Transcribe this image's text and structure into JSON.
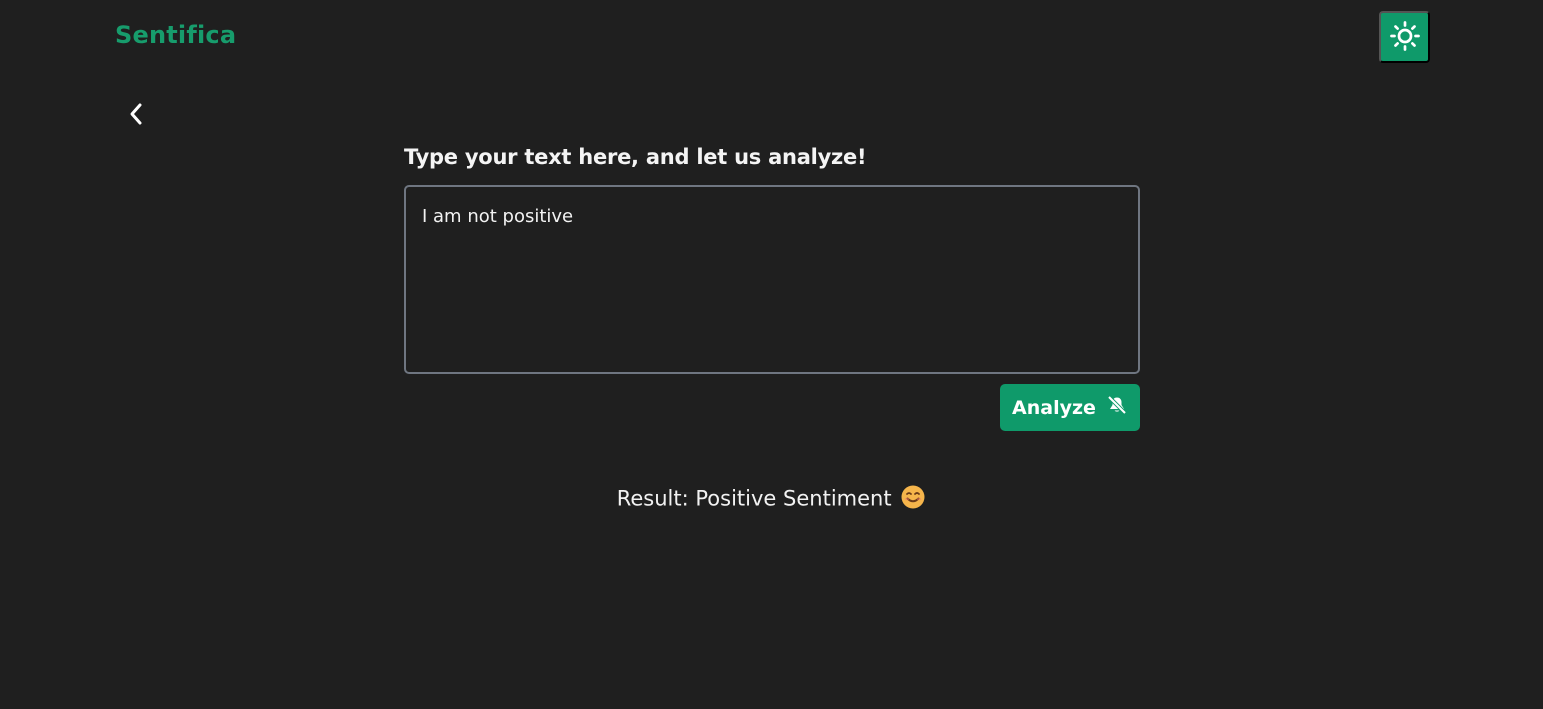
{
  "header": {
    "brand": "Sentifica",
    "theme_toggle_icon": "sun-icon"
  },
  "navigation": {
    "back_icon": "chevron-left-icon"
  },
  "analyzer": {
    "prompt_label": "Type your text here, and let us analyze!",
    "input_value": "I am not positive",
    "analyze_label": "Analyze",
    "analyze_icon": "bell-off-icon"
  },
  "result": {
    "prefix": "Result:",
    "sentiment": "Positive Sentiment",
    "emoji_icon": "smiling-face-icon"
  },
  "colors": {
    "background": "#1f1f1f",
    "accent": "#0f9a6a",
    "brand": "#179c6c",
    "input_border": "#6f7681",
    "text": "#f2f2f2"
  }
}
